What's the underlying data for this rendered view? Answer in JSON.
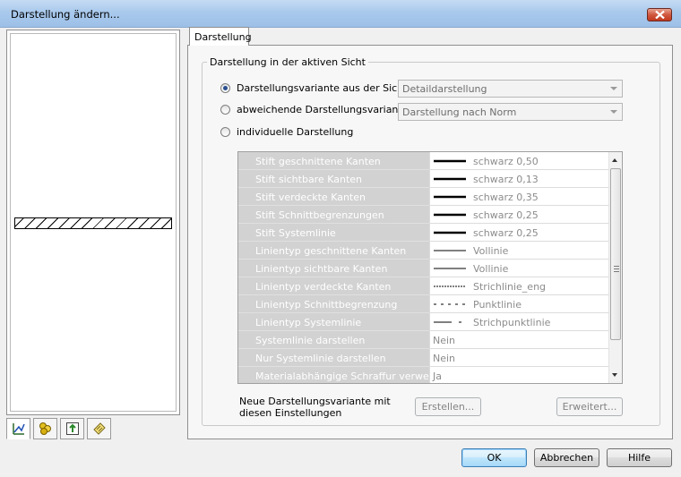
{
  "window": {
    "title": "Darstellung ändern..."
  },
  "main": {
    "tabs": [
      {
        "label": "Darstellung"
      }
    ],
    "group": {
      "title": "Darstellung in der aktiven Sicht",
      "options": [
        {
          "label": "Darstellungsvariante aus der Sicht",
          "selected": true,
          "combo_value": "Detaildarstellung"
        },
        {
          "label": "abweichende Darstellungsvariante",
          "selected": false,
          "combo_value": "Darstellung nach Norm"
        },
        {
          "label": "individuelle Darstellung",
          "selected": false
        }
      ],
      "properties": [
        {
          "name": "Stift geschnittene Kanten",
          "value": "schwarz 0,50",
          "line": "thick"
        },
        {
          "name": "Stift sichtbare Kanten",
          "value": "schwarz 0,13",
          "line": "thick"
        },
        {
          "name": "Stift verdeckte Kanten",
          "value": "schwarz 0,35",
          "line": "thick"
        },
        {
          "name": "Stift Schnittbegrenzungen",
          "value": "schwarz 0,25",
          "line": "thick"
        },
        {
          "name": "Stift Systemlinie",
          "value": "schwarz 0,25",
          "line": "thick"
        },
        {
          "name": "Linientyp geschnittene Kanten",
          "value": "Vollinie",
          "line": "solid"
        },
        {
          "name": "Linientyp sichtbare Kanten",
          "value": "Vollinie",
          "line": "solid"
        },
        {
          "name": "Linientyp verdeckte Kanten",
          "value": "Strichlinie_eng",
          "line": "dense-dash"
        },
        {
          "name": "Linientyp Schnittbegrenzung",
          "value": "Punktlinie",
          "line": "dots"
        },
        {
          "name": "Linientyp Systemlinie",
          "value": "Strichpunktlinie",
          "line": "dash-dot"
        },
        {
          "name": "Systemlinie darstellen",
          "value": "Nein",
          "line": "none"
        },
        {
          "name": "Nur Systemlinie darstellen",
          "value": "Nein",
          "line": "none"
        },
        {
          "name": "Materialabhängige Schraffur verwender",
          "value": "Ja",
          "line": "none"
        }
      ],
      "new_variant_label": "Neue Darstellungsvariante mit diesen Einstellungen",
      "create_button": "Erstellen...",
      "advanced_button": "Erweitert..."
    }
  },
  "footer": {
    "ok": "OK",
    "cancel": "Abbrechen",
    "help": "Hilfe"
  },
  "sidebar": {
    "tab_icons": [
      "line-style-icon",
      "material-icon",
      "export-icon",
      "note-icon"
    ]
  }
}
